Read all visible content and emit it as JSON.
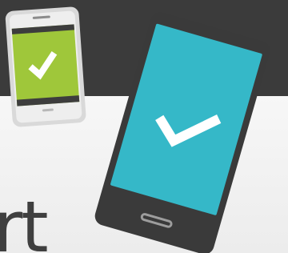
{
  "hero": {
    "heading_fragment": "rt"
  },
  "colors": {
    "dark_band": "#3b3b3b",
    "phone_screen": "#9fc73a",
    "tablet_screen": "#35b8c8",
    "device_frame": "#3a3a3a",
    "phone_body": "#d9d9d9",
    "heading": "#3f3f3f"
  },
  "icons": {
    "phone_check": "check-icon",
    "tablet_check": "check-icon",
    "tablet_home": "home-button-icon"
  }
}
